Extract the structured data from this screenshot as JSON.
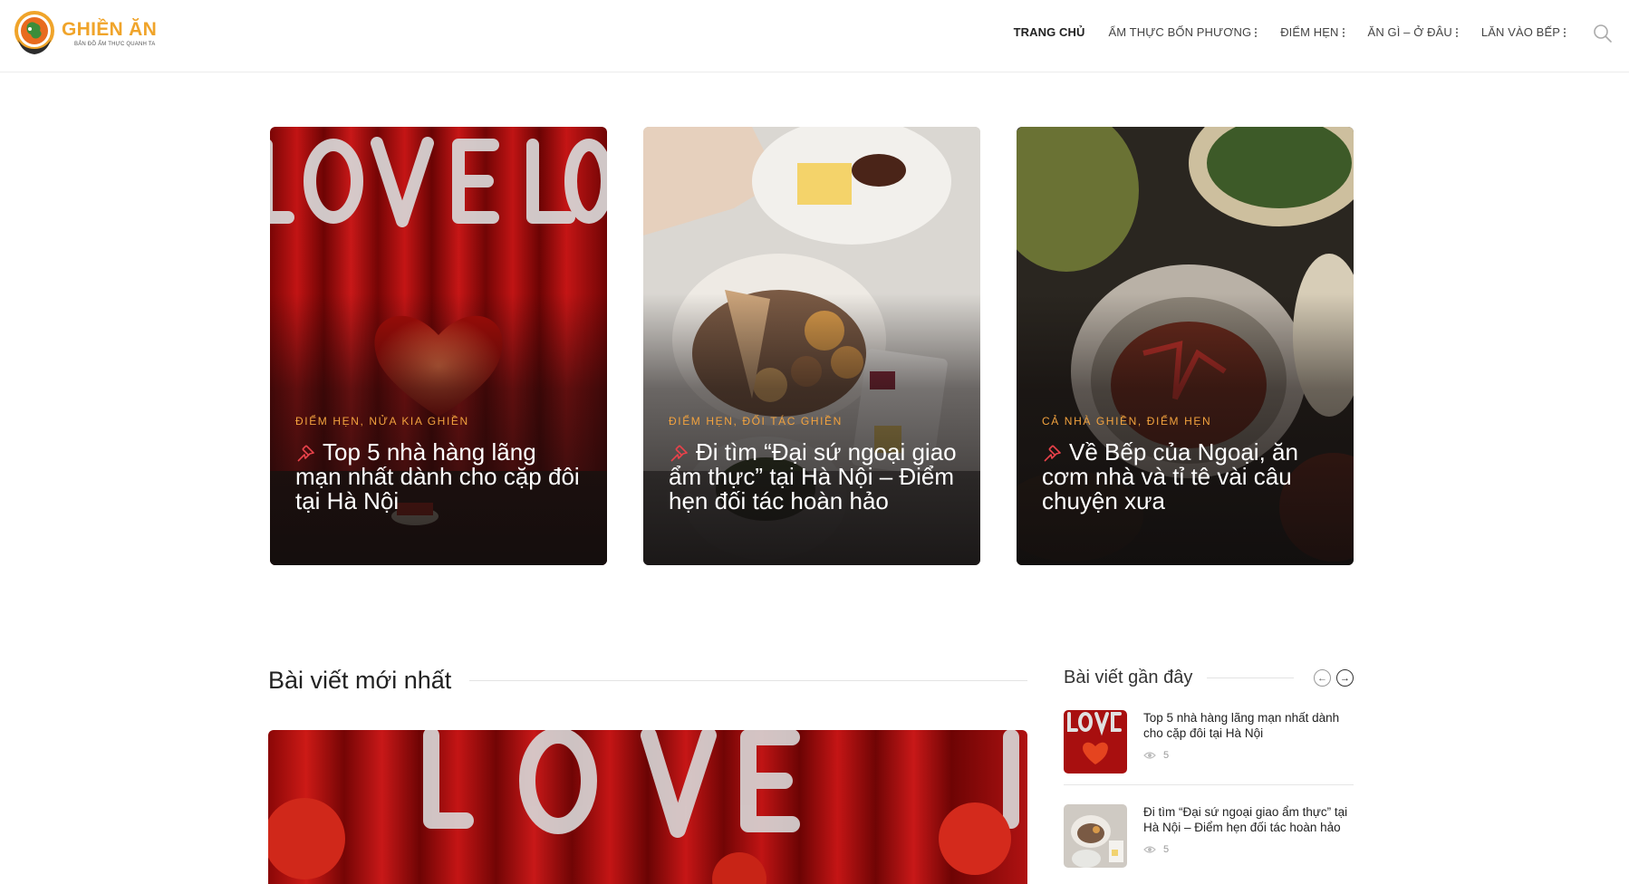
{
  "brand": {
    "name": "GHIỀN ĂN",
    "tagline": "BẢN ĐỒ ẨM THỰC QUANH TA",
    "accent": "#f0a42a"
  },
  "nav": {
    "items": [
      {
        "label": "TRANG CHỦ",
        "active": true,
        "has_menu": false
      },
      {
        "label": "ẨM THỰC BỐN PHƯƠNG",
        "active": false,
        "has_menu": true
      },
      {
        "label": "ĐIỂM HẸN",
        "active": false,
        "has_menu": true
      },
      {
        "label": "ĂN GÌ – Ở ĐÂU",
        "active": false,
        "has_menu": true
      },
      {
        "label": "LĂN VÀO BẾP",
        "active": false,
        "has_menu": true
      }
    ],
    "search_icon": "search-icon"
  },
  "featured": [
    {
      "categories": "ĐIỂM HẸN, NỬA KIA GHIỀN",
      "title": "Top 5 nhà hàng lãng mạn nhất dành cho cặp đôi tại Hà Nội"
    },
    {
      "categories": "ĐIỂM HẸN, ĐỐI TÁC GHIỀN",
      "title": "Đi tìm “Đại sứ ngoại giao ẩm thực” tại Hà Nội – Điểm hẹn đối tác hoàn hảo"
    },
    {
      "categories": "CẢ NHÀ GHIỀN, ĐIỂM HẸN",
      "title": "Về Bếp của Ngoại, ăn cơm nhà và tỉ tê vài câu chuyện xưa"
    }
  ],
  "latest": {
    "heading": "Bài viết mới nhất"
  },
  "sidebar": {
    "heading": "Bài viết gần đây",
    "items": [
      {
        "title": "Top 5 nhà hàng lãng mạn nhất dành cho cặp đôi tại Hà Nội",
        "views": "5"
      },
      {
        "title": "Đi tìm “Đại sứ ngoại giao ẩm thực” tại Hà Nội – Điểm hẹn đối tác hoàn hảo",
        "views": "5"
      }
    ]
  },
  "colors": {
    "category": "#f2a23e",
    "pin": "#e8424a"
  }
}
